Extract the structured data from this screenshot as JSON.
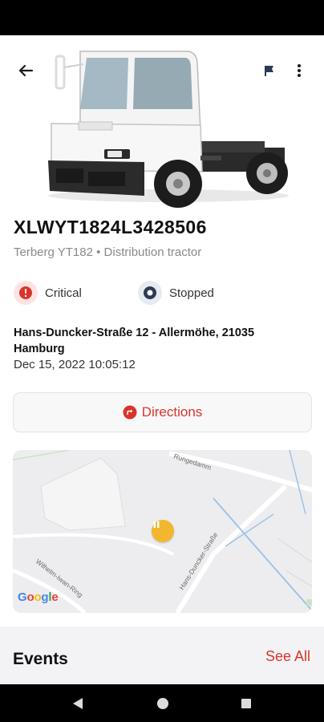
{
  "vehicle": {
    "id": "XLWYT1824L3428506",
    "model": "Terberg YT182 • Distribution tractor"
  },
  "status": {
    "severity": "Critical",
    "state": "Stopped"
  },
  "location": {
    "address": "Hans-Duncker-Straße 12 - Allermöhe, 21035 Hamburg",
    "timestamp": "Dec 15, 2022 10:05:12"
  },
  "directions": {
    "label": "Directions"
  },
  "map": {
    "street_labels": [
      "Rungedamm",
      "Hans-Duncker-Straße",
      "Wilhelm-Iwan-Ring"
    ],
    "logo": "Google"
  },
  "events": {
    "title": "Events",
    "see_all_label": "See All"
  },
  "icons": {
    "back": "arrow-back-icon",
    "flag": "flag-icon",
    "more": "more-vert-icon",
    "critical": "alert-icon",
    "stopped": "stopped-icon",
    "directions": "directions-icon",
    "marker": "pause-marker-icon"
  },
  "colors": {
    "accent": "#d9342b",
    "critical_bg": "#fde4e3",
    "marker": "#f2b72e",
    "stopped_icon": "#2c3a55"
  }
}
